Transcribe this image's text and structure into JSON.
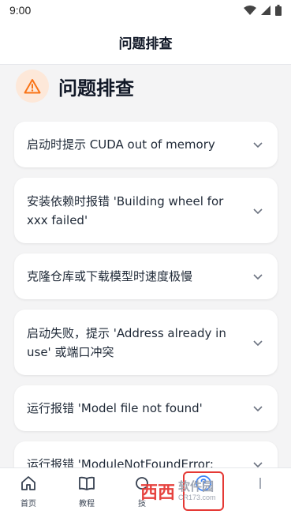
{
  "status_bar": {
    "time": "9:00"
  },
  "app_bar": {
    "title": "问题排查"
  },
  "section": {
    "title": "问题排查",
    "icon": "warning-icon"
  },
  "faq": [
    {
      "question": "启动时提示 CUDA out of memory"
    },
    {
      "question": "安装依赖时报错 'Building wheel for xxx failed'"
    },
    {
      "question": "克隆仓库或下载模型时速度极慢"
    },
    {
      "question": "启动失败，提示 'Address already in use' 或端口冲突"
    },
    {
      "question": "运行报错 'Model file not found'"
    },
    {
      "question": "运行报错 'ModuleNotFoundError:"
    }
  ],
  "bottom_nav": {
    "items": [
      {
        "label": "首页",
        "icon": "home-icon"
      },
      {
        "label": "教程",
        "icon": "book-icon"
      },
      {
        "label": "技",
        "icon": "tool-icon"
      },
      {
        "label": "",
        "icon": "help-circle-icon",
        "active": true
      },
      {
        "label": "",
        "icon": "more-icon"
      }
    ]
  },
  "watermark": {
    "brand": "软件园",
    "url": "CR173.com"
  },
  "colors": {
    "accent": "#e53935",
    "warning_bg": "#fde8d9",
    "warning_fg": "#f97316",
    "help_blue": "#3b82f6"
  }
}
